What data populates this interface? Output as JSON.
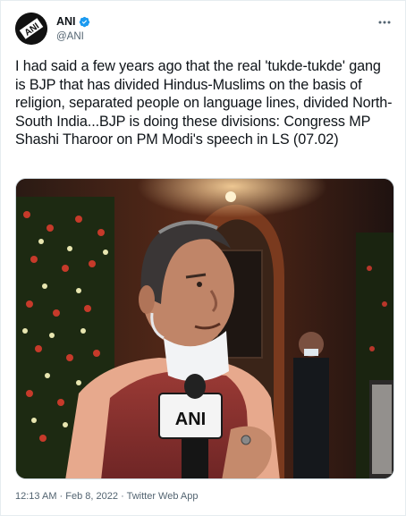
{
  "author": {
    "display_name": "ANI",
    "handle": "@ANI",
    "avatar_icon": "ani-logo-avatar",
    "verified_icon": "verified-badge-icon",
    "verified_color": "#1d9bf0"
  },
  "more_icon": "more-options-icon",
  "tweet": {
    "text": "I had said a few years ago that the real 'tukde-tukde' gang is BJP that has divided Hindus-Muslims on the basis of religion, separated people on language lines, divided North-South India...BJP is doing these divisions: Congress MP Shashi Tharoor on PM Modi's speech in LS (07.02)"
  },
  "media": {
    "mic_label": "ANI"
  },
  "meta": {
    "time": "12:13 AM",
    "separator1": "·",
    "date": "Feb 8, 2022",
    "separator2": "·",
    "source": "Twitter Web App"
  }
}
